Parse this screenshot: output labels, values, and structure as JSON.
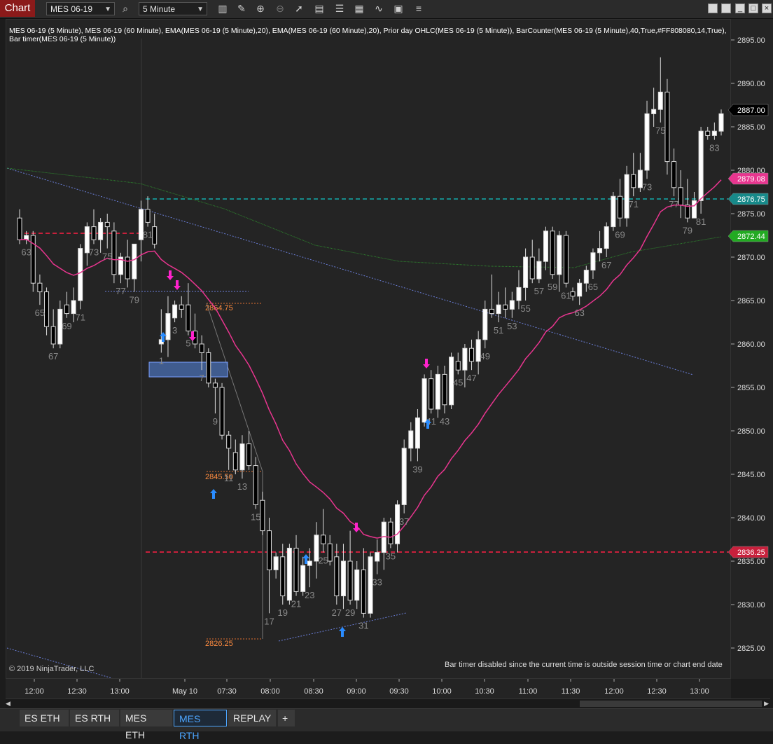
{
  "toolbar": {
    "badge": "Chart",
    "instrument": "MES 06-19",
    "interval": "5 Minute",
    "icons": [
      "search-icon",
      "bar-type-icon",
      "draw-icon",
      "zoom-in-icon",
      "zoom-out-icon",
      "pointer-icon",
      "properties-icon",
      "templates-icon",
      "strategies-icon",
      "more-icon"
    ]
  },
  "indicators_text": "MES 06-19 (5 Minute), MES 06-19 (60 Minute), EMA(MES 06-19 (5 Minute),20), EMA(MES 06-19 (60 Minute),20), Prior day OHLC(MES 06-19 (5 Minute)), BarCounter(MES 06-19 (5 Minute),40,True,#FF808080,14,True), Bar timer(MES 06-19 (5 Minute))",
  "copyright": "© 2019 NinjaTrader, LLC",
  "bar_timer_note": "Bar timer disabled since the current time is outside session time or chart end date",
  "price_axis": {
    "ticks": [
      "2895.00",
      "2890.00",
      "2885.00",
      "2880.00",
      "2875.00",
      "2870.00",
      "2865.00",
      "2860.00",
      "2855.00",
      "2850.00",
      "2845.00",
      "2840.00",
      "2835.00",
      "2830.00",
      "2825.00"
    ],
    "markers": [
      {
        "label": "2887.00",
        "bg": "#000000",
        "fg": "#ffffff"
      },
      {
        "label": "2879.08",
        "bg": "#e8358f",
        "fg": "#ffffff"
      },
      {
        "label": "2876.75",
        "bg": "#178a8a",
        "fg": "#ffffff"
      },
      {
        "label": "2872.44",
        "bg": "#22aa22",
        "fg": "#ffffff"
      },
      {
        "label": "2836.25",
        "bg": "#c8203c",
        "fg": "#ffffff"
      }
    ]
  },
  "time_axis": [
    "12:00",
    "12:30",
    "13:00",
    "May 10",
    "07:30",
    "08:00",
    "08:30",
    "09:00",
    "09:30",
    "10:00",
    "10:30",
    "11:00",
    "11:30",
    "12:00",
    "12:30",
    "13:00"
  ],
  "level_labels": [
    "2864.75",
    "2845.50",
    "2826.25"
  ],
  "tabs": [
    {
      "label": "ES ETH",
      "active": false
    },
    {
      "label": "ES RTH",
      "active": false
    },
    {
      "label": "MES ETH",
      "active": false
    },
    {
      "label": "MES RTH",
      "active": true
    },
    {
      "label": "REPLAY",
      "active": false
    }
  ],
  "add_tab_label": "+",
  "colors": {
    "ema5": "#e8358f",
    "ema60": "#2e8b2e",
    "prior_high": "#c8203c",
    "prior_low": "#c8203c",
    "teal_line": "#178a8a",
    "up_bar": "#ffffff",
    "down_bar": "#000000"
  },
  "chart_data": {
    "type": "candlestick",
    "instrument": "MES 06-19",
    "ylim": [
      2822,
      2898
    ],
    "horizontal_levels": [
      2872.5,
      2836.25,
      2876.75
    ],
    "bars": [
      [
        2874.5,
        2875.5,
        2871.5,
        2872.0
      ],
      [
        2872.0,
        2873.0,
        2871.5,
        2872.5
      ],
      [
        2872.5,
        2873.0,
        2866.0,
        2867.0
      ],
      [
        2867.0,
        2868.0,
        2864.5,
        2866.0
      ],
      [
        2866.0,
        2866.5,
        2861.0,
        2862.0
      ],
      [
        2862.0,
        2864.0,
        2859.5,
        2860.0
      ],
      [
        2860.0,
        2865.0,
        2859.5,
        2864.0
      ],
      [
        2864.5,
        2866.0,
        2863.0,
        2863.5
      ],
      [
        2863.5,
        2866.5,
        2862.5,
        2865.0
      ],
      [
        2865.0,
        2871.5,
        2864.0,
        2871.0
      ],
      [
        2870.5,
        2874.0,
        2869.0,
        2873.5
      ],
      [
        2873.5,
        2875.5,
        2871.5,
        2872.0
      ],
      [
        2872.0,
        2874.5,
        2870.5,
        2874.0
      ],
      [
        2874.0,
        2875.0,
        2871.0,
        2873.5
      ],
      [
        2873.0,
        2874.0,
        2867.0,
        2868.0
      ],
      [
        2868.0,
        2870.5,
        2867.0,
        2870.0
      ],
      [
        2870.0,
        2872.0,
        2866.5,
        2867.5
      ],
      [
        2867.5,
        2871.0,
        2866.0,
        2871.5
      ],
      [
        2872.0,
        2876.5,
        2869.5,
        2875.5
      ],
      [
        2875.5,
        2877.0,
        2873.5,
        2874.0
      ],
      [
        2873.5,
        2875.0,
        2871.0,
        2871.5
      ],
      [
        2860.0,
        2864.0,
        2859.0,
        2860.5
      ],
      [
        2860.5,
        2865.5,
        2858.5,
        2863.5
      ],
      [
        2863.0,
        2865.0,
        2862.5,
        2864.5
      ],
      [
        2864.5,
        2865.5,
        2863.0,
        2864.0
      ],
      [
        2864.5,
        2867.0,
        2861.0,
        2861.5
      ],
      [
        2861.5,
        2863.5,
        2859.5,
        2860.0
      ],
      [
        2860.0,
        2861.0,
        2857.0,
        2859.0
      ],
      [
        2859.0,
        2859.5,
        2855.0,
        2855.5
      ],
      [
        2855.5,
        2856.0,
        2852.0,
        2855.0
      ],
      [
        2855.0,
        2855.5,
        2849.0,
        2849.5
      ],
      [
        2849.5,
        2850.0,
        2845.5,
        2848.0
      ],
      [
        2847.5,
        2849.0,
        2845.0,
        2845.5
      ],
      [
        2845.5,
        2849.5,
        2844.5,
        2848.5
      ],
      [
        2848.5,
        2850.0,
        2845.5,
        2846.0
      ],
      [
        2846.0,
        2847.0,
        2841.0,
        2841.5
      ],
      [
        2842.0,
        2843.0,
        2838.0,
        2838.5
      ],
      [
        2838.5,
        2840.0,
        2829.0,
        2834.0
      ],
      [
        2834.0,
        2836.0,
        2833.0,
        2835.5
      ],
      [
        2835.5,
        2837.0,
        2830.0,
        2831.0
      ],
      [
        2830.5,
        2837.0,
        2830.0,
        2836.5
      ],
      [
        2836.5,
        2838.0,
        2831.0,
        2831.5
      ],
      [
        2831.5,
        2835.5,
        2831.0,
        2834.5
      ],
      [
        2834.5,
        2836.5,
        2832.0,
        2835.0
      ],
      [
        2835.0,
        2839.5,
        2833.0,
        2838.0
      ],
      [
        2838.0,
        2841.0,
        2836.0,
        2837.0
      ],
      [
        2837.0,
        2838.0,
        2834.5,
        2835.0
      ],
      [
        2835.5,
        2837.0,
        2830.0,
        2831.0
      ],
      [
        2831.0,
        2837.0,
        2829.5,
        2835.0
      ],
      [
        2835.0,
        2838.5,
        2830.0,
        2830.5
      ],
      [
        2830.5,
        2835.0,
        2829.5,
        2834.0
      ],
      [
        2834.0,
        2836.5,
        2828.5,
        2829.0
      ],
      [
        2829.0,
        2836.0,
        2828.5,
        2835.5
      ],
      [
        2835.0,
        2837.5,
        2833.5,
        2836.0
      ],
      [
        2836.0,
        2840.0,
        2834.0,
        2839.5
      ],
      [
        2839.5,
        2840.0,
        2836.5,
        2837.0
      ],
      [
        2837.0,
        2842.0,
        2836.0,
        2841.5
      ],
      [
        2841.5,
        2849.0,
        2840.5,
        2848.0
      ],
      [
        2848.0,
        2851.0,
        2846.5,
        2850.0
      ],
      [
        2848.0,
        2852.5,
        2846.5,
        2851.5
      ],
      [
        2851.0,
        2856.5,
        2850.5,
        2856.0
      ],
      [
        2856.0,
        2857.0,
        2852.0,
        2852.5
      ],
      [
        2852.5,
        2857.5,
        2851.5,
        2856.5
      ],
      [
        2856.5,
        2857.5,
        2852.0,
        2853.0
      ],
      [
        2853.0,
        2859.0,
        2852.5,
        2858.5
      ],
      [
        2858.0,
        2859.0,
        2856.5,
        2857.0
      ],
      [
        2857.0,
        2860.0,
        2855.0,
        2859.5
      ],
      [
        2859.5,
        2860.5,
        2857.0,
        2858.0
      ],
      [
        2858.0,
        2861.5,
        2856.5,
        2860.5
      ],
      [
        2860.5,
        2865.0,
        2859.5,
        2864.0
      ],
      [
        2864.0,
        2868.0,
        2863.0,
        2863.5
      ],
      [
        2863.5,
        2866.0,
        2862.5,
        2864.5
      ],
      [
        2864.5,
        2866.5,
        2863.0,
        2864.0
      ],
      [
        2864.0,
        2866.0,
        2863.0,
        2865.0
      ],
      [
        2865.0,
        2868.5,
        2864.0,
        2866.5
      ],
      [
        2866.5,
        2871.0,
        2865.0,
        2870.0
      ],
      [
        2870.0,
        2872.0,
        2867.0,
        2867.5
      ],
      [
        2867.5,
        2871.0,
        2867.0,
        2869.5
      ],
      [
        2869.5,
        2873.5,
        2868.5,
        2873.0
      ],
      [
        2873.0,
        2873.5,
        2867.5,
        2868.0
      ],
      [
        2868.0,
        2873.0,
        2866.0,
        2872.5
      ],
      [
        2872.5,
        2873.0,
        2866.5,
        2867.0
      ],
      [
        2866.0,
        2866.5,
        2865.0,
        2865.5
      ],
      [
        2865.5,
        2867.5,
        2864.5,
        2867.0
      ],
      [
        2867.0,
        2869.0,
        2866.0,
        2868.5
      ],
      [
        2868.5,
        2871.0,
        2867.5,
        2870.5
      ],
      [
        2870.5,
        2873.0,
        2869.5,
        2871.0
      ],
      [
        2871.0,
        2874.0,
        2870.0,
        2873.5
      ],
      [
        2873.5,
        2877.5,
        2873.0,
        2877.0
      ],
      [
        2877.0,
        2879.0,
        2873.5,
        2874.5
      ],
      [
        2874.5,
        2880.5,
        2873.5,
        2879.5
      ],
      [
        2879.5,
        2882.0,
        2877.0,
        2878.0
      ],
      [
        2878.0,
        2882.0,
        2877.5,
        2880.0
      ],
      [
        2880.0,
        2888.0,
        2879.0,
        2886.5
      ],
      [
        2886.5,
        2889.5,
        2885.0,
        2887.0
      ],
      [
        2887.0,
        2893.0,
        2885.5,
        2889.0
      ],
      [
        2889.0,
        2890.5,
        2879.5,
        2881.0
      ],
      [
        2881.0,
        2882.5,
        2877.0,
        2878.0
      ],
      [
        2878.0,
        2880.0,
        2874.5,
        2876.0
      ],
      [
        2876.0,
        2879.0,
        2874.0,
        2874.5
      ],
      [
        2874.5,
        2877.5,
        2874.5,
        2876.5
      ],
      [
        2876.5,
        2885.0,
        2875.0,
        2884.5
      ],
      [
        2884.5,
        2885.0,
        2883.5,
        2884.0
      ],
      [
        2884.0,
        2885.5,
        2883.5,
        2884.5
      ],
      [
        2884.5,
        2887.0,
        2884.0,
        2886.5
      ]
    ]
  }
}
